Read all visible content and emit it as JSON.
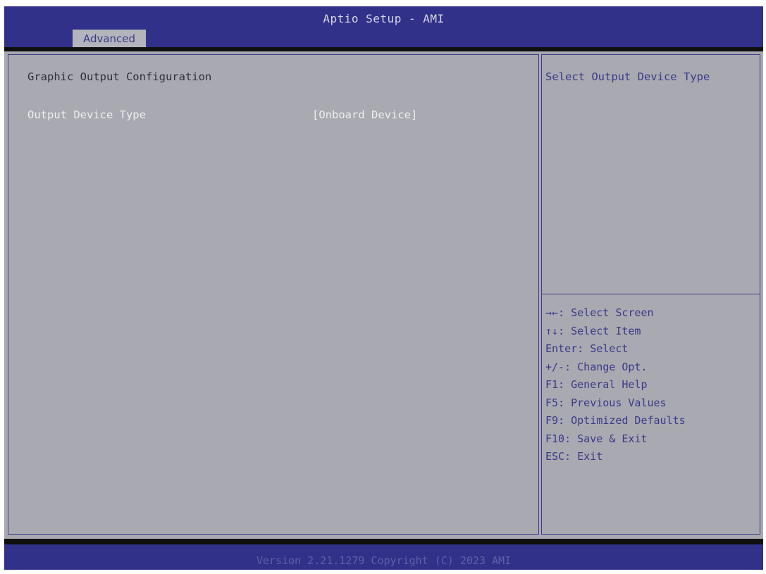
{
  "title": "Aptio Setup - AMI",
  "tabs": [
    {
      "label": "Advanced",
      "active": true
    }
  ],
  "main": {
    "heading": "Graphic Output Configuration",
    "settings": [
      {
        "label": "Output Device Type",
        "value": "[Onboard Device]"
      }
    ]
  },
  "help": {
    "text": "Select Output Device Type",
    "keys": [
      "→←: Select Screen",
      "↑↓: Select Item",
      "Enter: Select",
      "+/-: Change Opt.",
      "F1: General Help",
      "F5: Previous Values",
      "F9: Optimized Defaults",
      "F10: Save & Exit",
      "ESC: Exit"
    ]
  },
  "footer": {
    "version": "Version 2.21.1279 Copyright (C) 2023 AMI"
  },
  "colors": {
    "title_bar": "#32318a",
    "content_bg": "#a9a9b1",
    "tab_bg": "#b4b4bc",
    "text_blue": "#3a3a8a",
    "text_white": "#ededf2"
  }
}
